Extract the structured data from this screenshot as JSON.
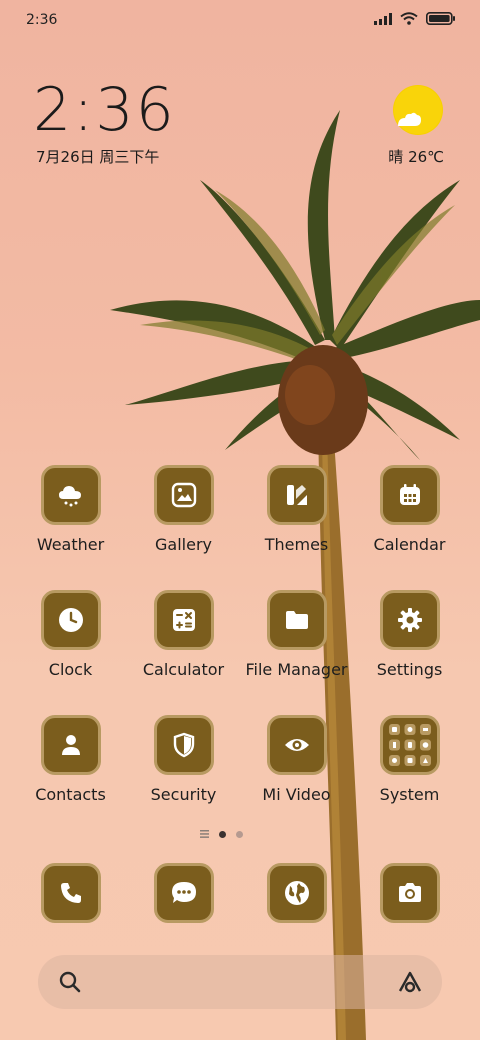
{
  "status_bar": {
    "time": "2:36"
  },
  "lockclock": {
    "time": "2:36",
    "date": "7月26日 周三下午",
    "weather": "晴 26℃"
  },
  "apps": [
    {
      "label": "Weather",
      "icon": "weather-icon"
    },
    {
      "label": "Gallery",
      "icon": "gallery-icon"
    },
    {
      "label": "Themes",
      "icon": "themes-icon"
    },
    {
      "label": "Calendar",
      "icon": "calendar-icon"
    },
    {
      "label": "Clock",
      "icon": "clock-icon"
    },
    {
      "label": "Calculator",
      "icon": "calculator-icon"
    },
    {
      "label": "File Manager",
      "icon": "folder-icon"
    },
    {
      "label": "Settings",
      "icon": "gear-icon"
    },
    {
      "label": "Contacts",
      "icon": "contact-icon"
    },
    {
      "label": "Security",
      "icon": "shield-icon"
    },
    {
      "label": "Mi Video",
      "icon": "eye-icon"
    },
    {
      "label": "System",
      "icon": "folder-grid-icon"
    }
  ],
  "dock": [
    {
      "icon": "phone-icon"
    },
    {
      "icon": "message-icon"
    },
    {
      "icon": "browser-globe-icon"
    },
    {
      "icon": "camera-icon"
    }
  ],
  "pages": {
    "count": 2,
    "current": 1
  },
  "colors": {
    "tile": "#7b5d1d",
    "tile_border": "#b89a62",
    "sun": "#f8d000"
  }
}
